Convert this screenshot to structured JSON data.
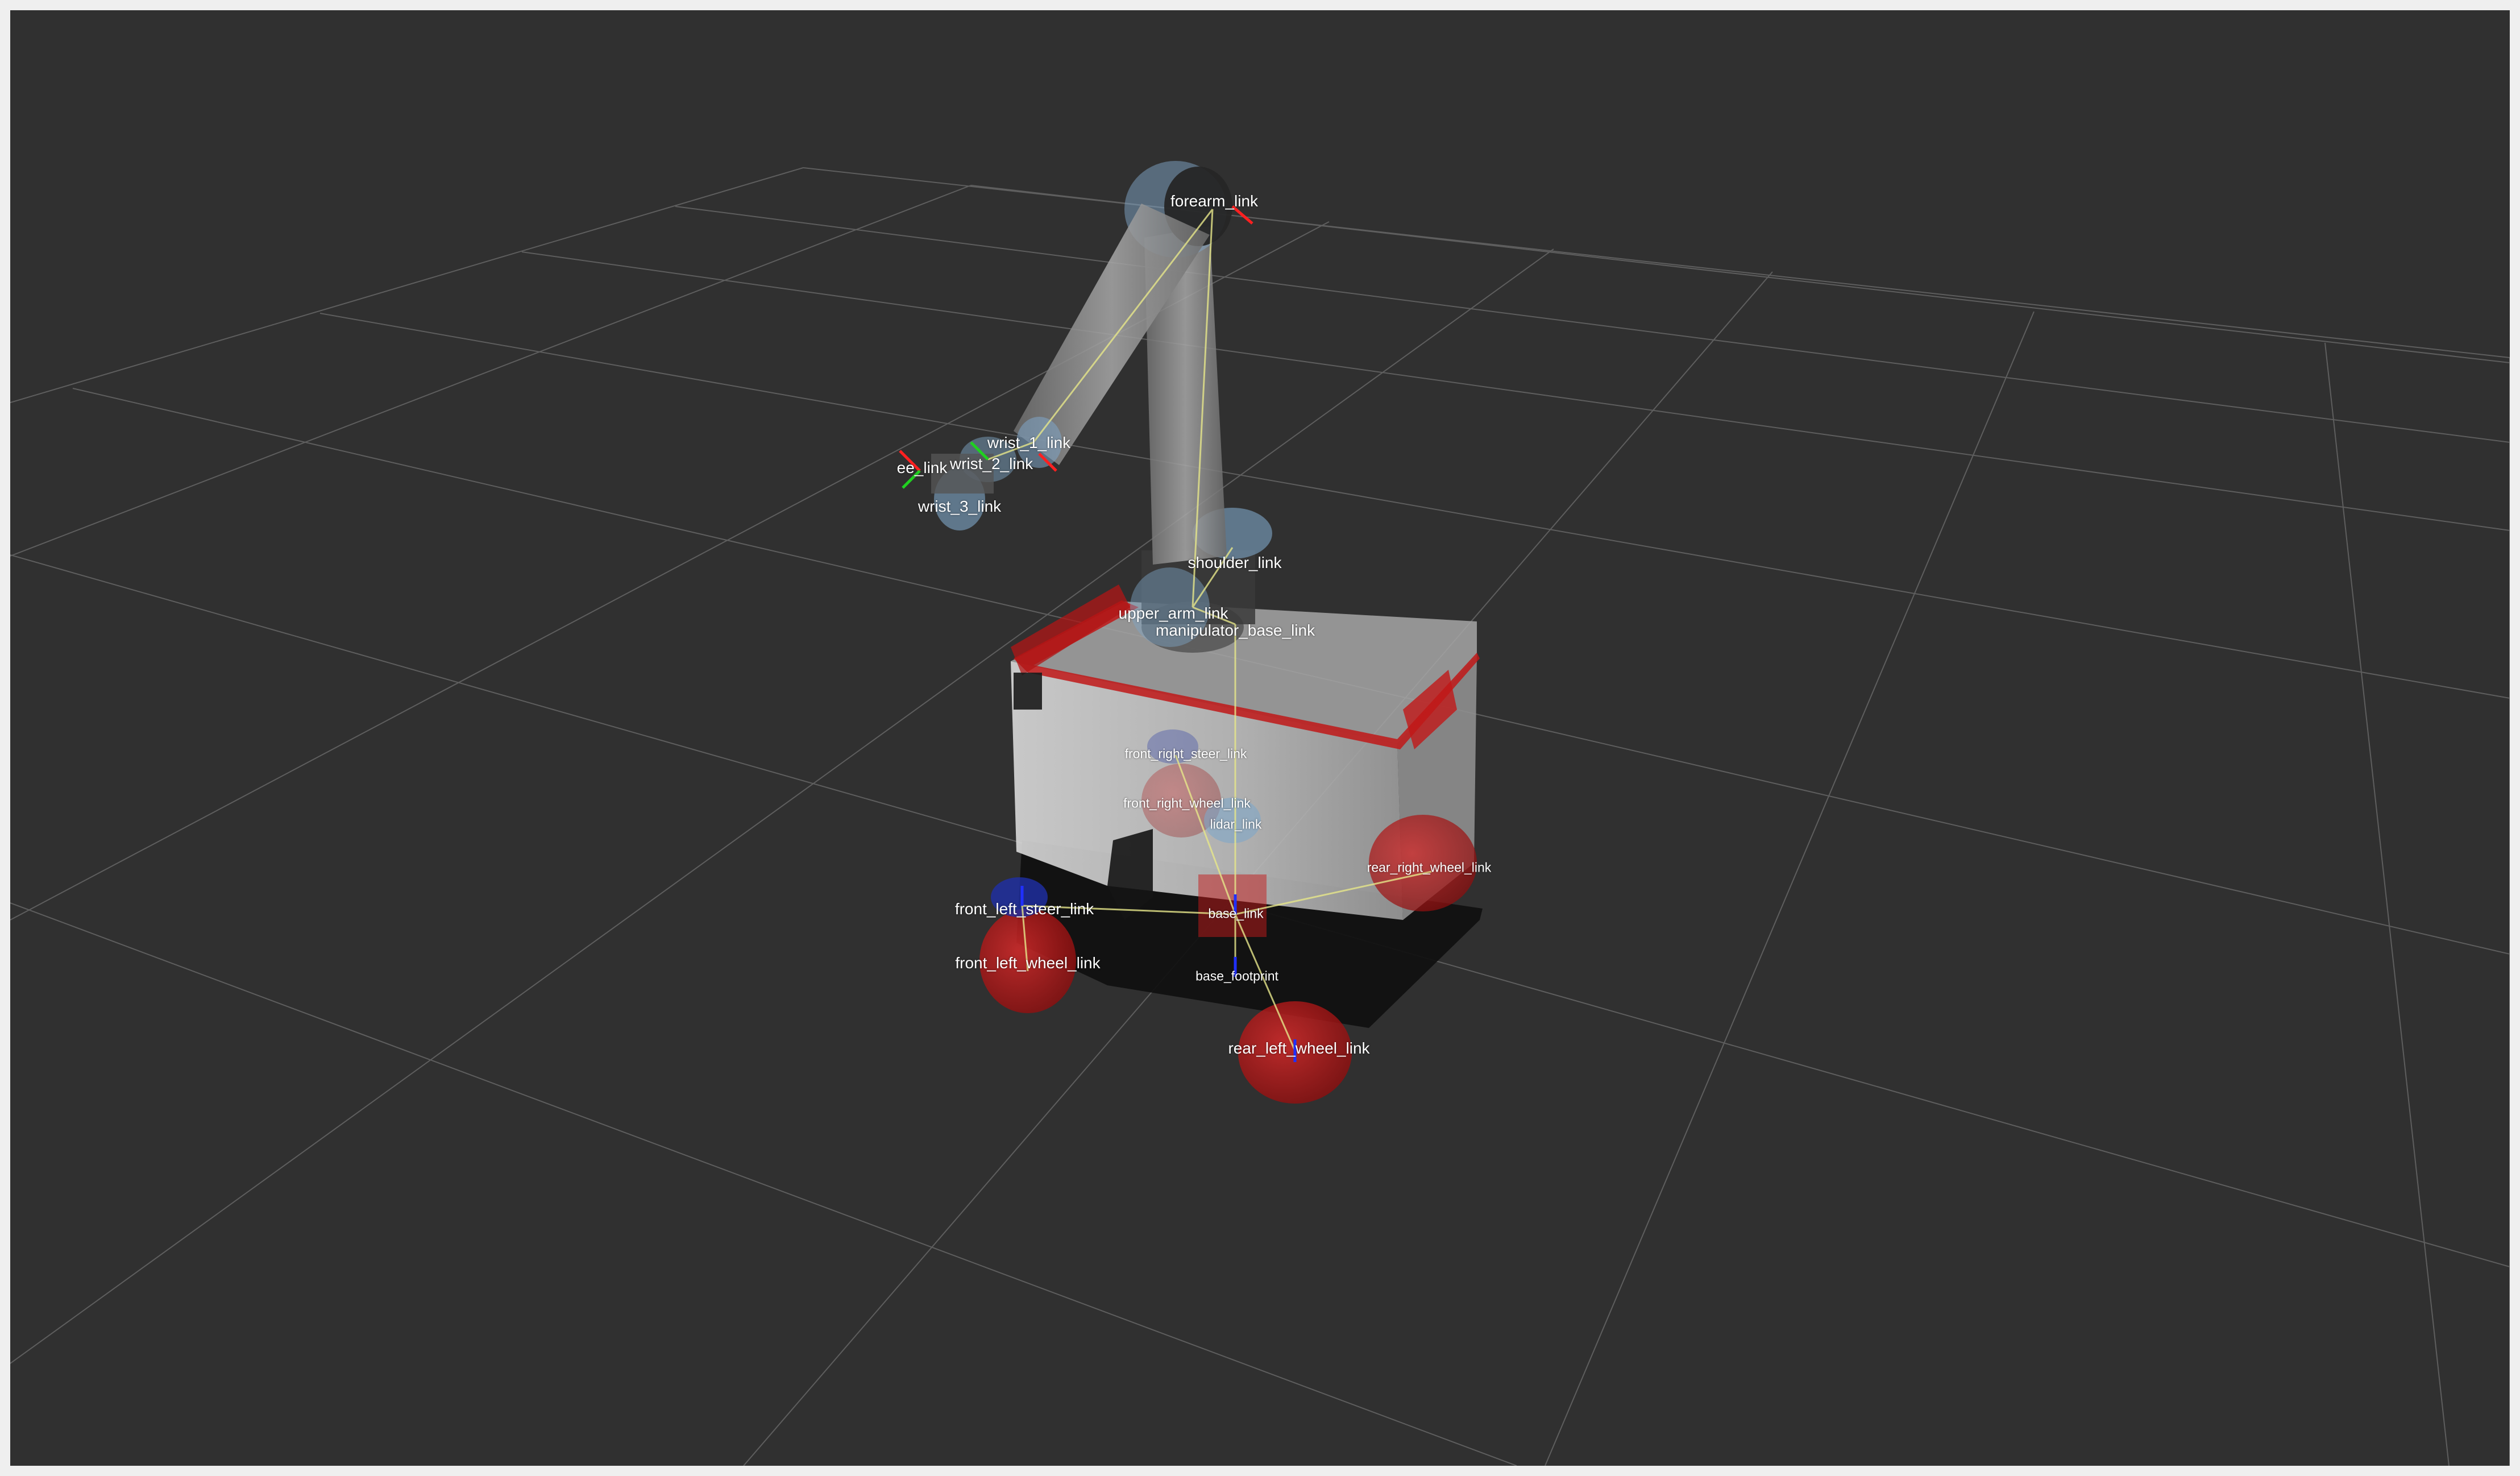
{
  "viewer": {
    "background_color": "#303030",
    "grid_color": "#5e5e5e",
    "frames": [
      {
        "key": "forearm_link",
        "label": "forearm_link"
      },
      {
        "key": "wrist_1_link",
        "label": "wrist_1_link"
      },
      {
        "key": "wrist_2_link",
        "label": "wrist_2_link"
      },
      {
        "key": "ee_link",
        "label": "ee_link"
      },
      {
        "key": "wrist_3_link",
        "label": "wrist_3_link"
      },
      {
        "key": "shoulder_link",
        "label": "shoulder_link"
      },
      {
        "key": "upper_arm_link",
        "label": "upper_arm_link"
      },
      {
        "key": "manipulator_base_link",
        "label": "manipulator_base_link"
      },
      {
        "key": "front_right_steer_link",
        "label": "front_right_steer_link"
      },
      {
        "key": "front_right_wheel_link",
        "label": "front_right_wheel_link"
      },
      {
        "key": "lidar_link",
        "label": "lidar_link"
      },
      {
        "key": "rear_right_wheel_link",
        "label": "rear_right_wheel_link"
      },
      {
        "key": "front_left_steer_link",
        "label": "front_left_steer_link"
      },
      {
        "key": "base_link",
        "label": "base_link"
      },
      {
        "key": "front_left_wheel_link",
        "label": "front_left_wheel_link"
      },
      {
        "key": "base_footprint",
        "label": "base_footprint"
      },
      {
        "key": "rear_left_wheel_link",
        "label": "rear_left_wheel_link"
      }
    ],
    "colors": {
      "body": "#b8b8b8",
      "body_accent": "#c01818",
      "wheel": "#c41a1a",
      "arm_link": "#9a9a9a",
      "joint": "#7fa6c8",
      "tf_x": "#ff2020",
      "tf_y": "#20d020",
      "tf_z": "#2030ff",
      "tf_connector": "#e6e68a"
    }
  }
}
